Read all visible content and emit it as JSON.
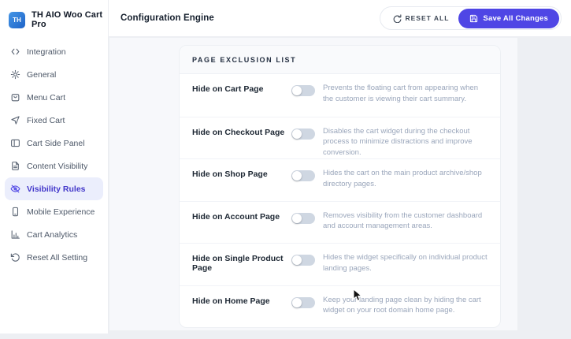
{
  "brand": {
    "logo_text": "TH",
    "name": "TH AIO Woo Cart Pro"
  },
  "header": {
    "title": "Configuration Engine",
    "reset_label": "RESET ALL",
    "save_label": "Save All Changes"
  },
  "sidebar": {
    "items": [
      {
        "icon": "code-icon",
        "label": "Integration",
        "active": false
      },
      {
        "icon": "gear-icon",
        "label": "General",
        "active": false
      },
      {
        "icon": "menu-cart-icon",
        "label": "Menu Cart",
        "active": false
      },
      {
        "icon": "cursor-icon",
        "label": "Fixed Cart",
        "active": false
      },
      {
        "icon": "side-panel-icon",
        "label": "Cart Side Panel",
        "active": false
      },
      {
        "icon": "document-icon",
        "label": "Content Visibility",
        "active": false
      },
      {
        "icon": "eye-off-icon",
        "label": "Visibility Rules",
        "active": true
      },
      {
        "icon": "phone-icon",
        "label": "Mobile Experience",
        "active": false
      },
      {
        "icon": "bar-chart-icon",
        "label": "Cart Analytics",
        "active": false
      },
      {
        "icon": "refresh-icon",
        "label": "Reset All Setting",
        "active": false
      }
    ]
  },
  "panel": {
    "title": "PAGE EXCLUSION LIST",
    "rows": [
      {
        "label": "Hide on Cart Page",
        "toggle_on": false,
        "description": "Prevents the floating cart from appearing when the customer is viewing their cart summary."
      },
      {
        "label": "Hide on Checkout Page",
        "toggle_on": false,
        "description": "Disables the cart widget during the checkout process to minimize distractions and improve conversion."
      },
      {
        "label": "Hide on Shop Page",
        "toggle_on": false,
        "description": "Hides the cart on the main product archive/shop directory pages."
      },
      {
        "label": "Hide on Account Page",
        "toggle_on": false,
        "description": "Removes visibility from the customer dashboard and account management areas."
      },
      {
        "label": "Hide on Single Product Page",
        "toggle_on": false,
        "description": "Hides the widget specifically on individual product landing pages."
      },
      {
        "label": "Hide on Home Page",
        "toggle_on": false,
        "description": "Keep your landing page clean by hiding the cart widget on your root domain home page."
      }
    ]
  },
  "colors": {
    "accent": "#4f46e5",
    "active_item_bg": "#ebeefc",
    "active_item_text": "#4338ca",
    "content_bg": "#f7f8fb",
    "toggle_track_off": "#cfd7e2",
    "description_text": "#9aa6bb",
    "logo_blue": "#1d63c8"
  }
}
